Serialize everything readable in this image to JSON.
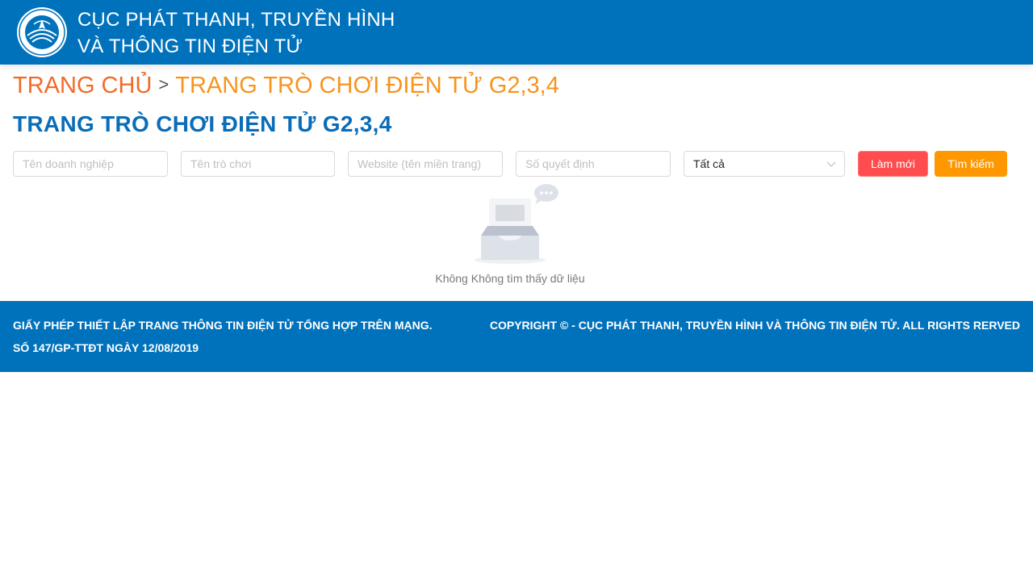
{
  "header": {
    "title_line1": "CỤC PHÁT THANH, TRUYỀN HÌNH",
    "title_line2": "VÀ THÔNG TIN ĐIỆN TỬ",
    "logo_icon": "ministry-emblem-icon"
  },
  "breadcrumb": {
    "home": "TRANG CHỦ",
    "separator": ">",
    "current": "TRANG TRÒ CHƠI ĐIỆN TỬ G2,3,4"
  },
  "page_title": "TRANG TRÒ CHƠI ĐIỆN TỬ G2,3,4",
  "filters": {
    "company_placeholder": "Tên doanh nghiệp",
    "game_placeholder": "Tên trò chơi",
    "website_placeholder": "Website (tên miền trang)",
    "decision_placeholder": "Số quyết định",
    "select_value": "Tất cả",
    "reset_label": "Làm mới",
    "search_label": "Tìm kiếm"
  },
  "empty": {
    "message": "Không Không tìm thấy dữ liệu"
  },
  "footer": {
    "license_line1": "GIẤY PHÉP THIẾT LẬP TRANG THÔNG TIN ĐIỆN TỬ TỔNG HỢP TRÊN MẠNG.",
    "license_line2": "SỐ 147/GP-TTĐT NGÀY 12/08/2019",
    "copyright": "COPYRIGHT © - CỤC PHÁT THANH, TRUYỀN HÌNH VÀ THÔNG TIN ĐIỆN TỬ. ALL RIGHTS RERVED"
  },
  "colors": {
    "header_bg": "#0072bc",
    "breadcrumb_home": "#f26a28",
    "breadcrumb_current": "#f7941d",
    "title": "#0a6db8",
    "reset_btn": "#ff4d4f",
    "search_btn": "#ff9800"
  }
}
